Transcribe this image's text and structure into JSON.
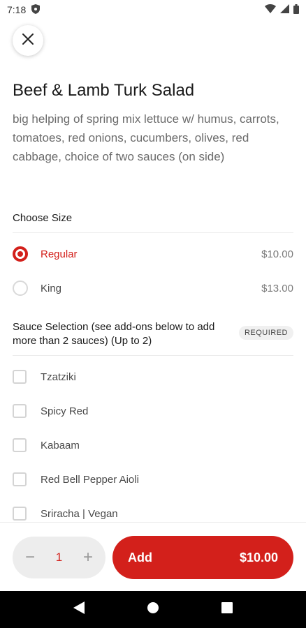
{
  "status_bar": {
    "time": "7:18"
  },
  "item": {
    "title": "Beef & Lamb Turk Salad",
    "description": "big helping of spring mix lettuce w/ humus, carrots, tomatoes, red onions, cucumbers, olives, red cabbage, choice of two sauces (on side)"
  },
  "size_section": {
    "title": "Choose Size",
    "options": [
      {
        "label": "Regular",
        "price": "$10.00",
        "selected": true
      },
      {
        "label": "King",
        "price": "$13.00",
        "selected": false
      }
    ]
  },
  "sauce_section": {
    "title": "Sauce Selection (see add-ons below to add more than 2 sauces) (Up to 2)",
    "badge": "REQUIRED",
    "options": [
      {
        "label": "Tzatziki"
      },
      {
        "label": "Spicy Red"
      },
      {
        "label": "Kabaam"
      },
      {
        "label": "Red Bell Pepper Aioli"
      },
      {
        "label": "Sriracha | Vegan"
      }
    ]
  },
  "footer": {
    "quantity": "1",
    "minus": "−",
    "plus": "+",
    "add_label": "Add",
    "add_price": "$10.00"
  },
  "colors": {
    "accent": "#d3201b"
  }
}
